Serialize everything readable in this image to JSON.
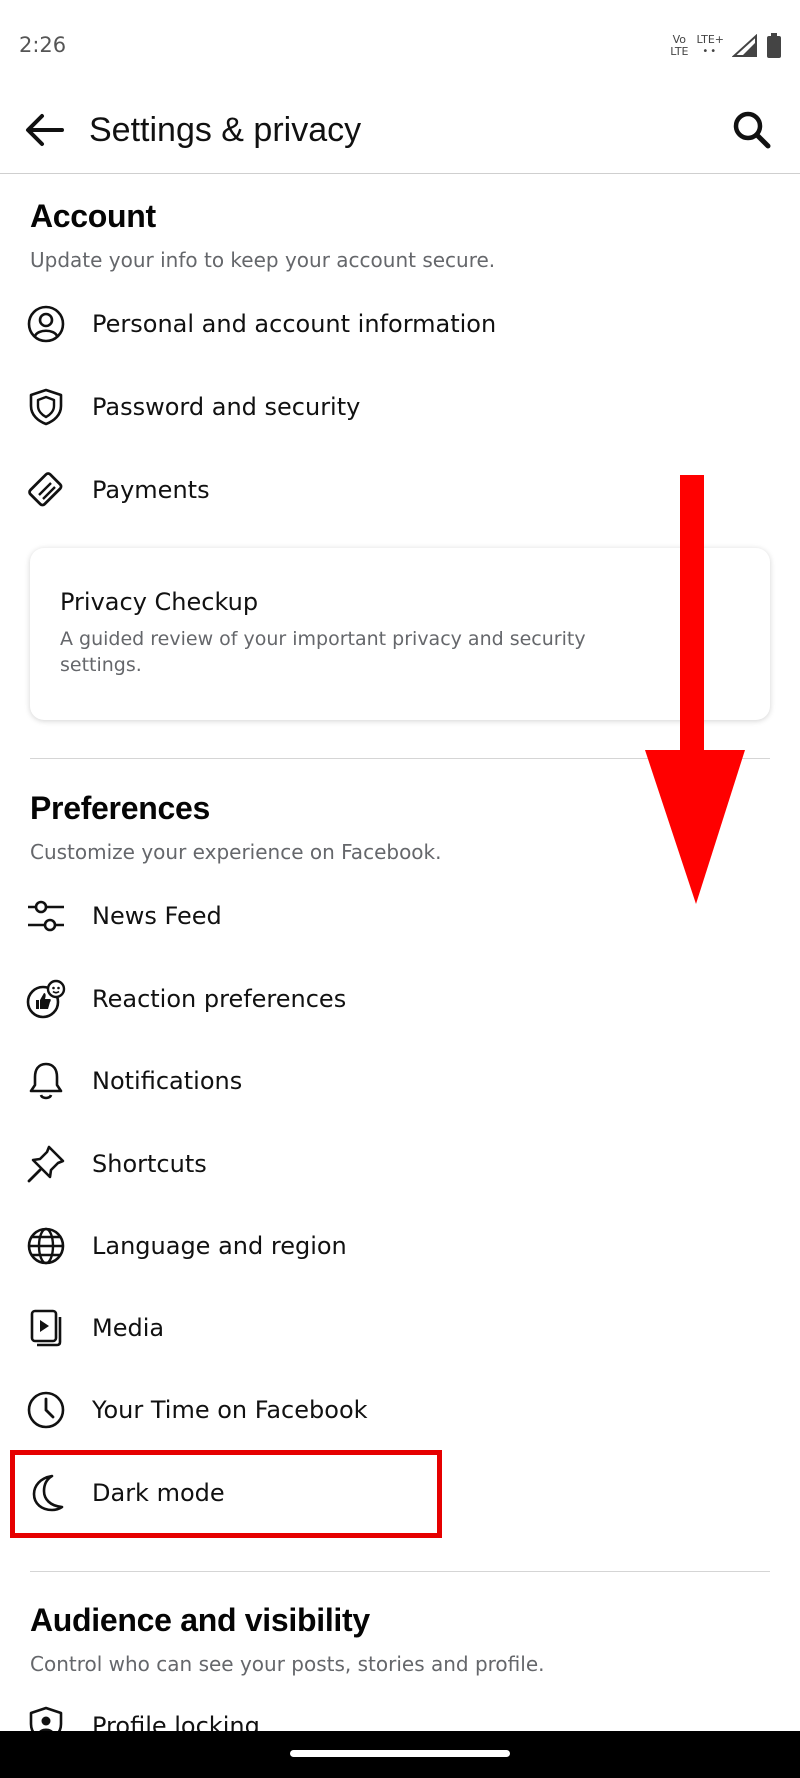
{
  "status_bar": {
    "time": "2:26",
    "volte_top": "Vo",
    "volte_bottom": "LTE",
    "lte_top": "LTE+",
    "lte_bottom": "••"
  },
  "header": {
    "title": "Settings & privacy",
    "back_icon": "arrow-left-icon",
    "search_icon": "search-icon"
  },
  "account": {
    "title": "Account",
    "subtitle": "Update your info to keep your account secure.",
    "items": [
      {
        "label": "Personal and account information",
        "icon": "user-circle-icon"
      },
      {
        "label": "Password and security",
        "icon": "shield-icon"
      },
      {
        "label": "Payments",
        "icon": "tag-icon"
      }
    ]
  },
  "privacy_checkup": {
    "title": "Privacy Checkup",
    "description": "A guided review of your important privacy and security settings."
  },
  "preferences": {
    "title": "Preferences",
    "subtitle": "Customize your experience on Facebook.",
    "items": [
      {
        "label": "News Feed",
        "icon": "sliders-icon"
      },
      {
        "label": "Reaction preferences",
        "icon": "reaction-icon"
      },
      {
        "label": "Notifications",
        "icon": "bell-icon"
      },
      {
        "label": "Shortcuts",
        "icon": "pin-icon"
      },
      {
        "label": "Language and region",
        "icon": "globe-icon"
      },
      {
        "label": "Media",
        "icon": "media-icon"
      },
      {
        "label": "Your Time on Facebook",
        "icon": "clock-icon"
      },
      {
        "label": "Dark mode",
        "icon": "moon-icon"
      }
    ]
  },
  "audience": {
    "title": "Audience and visibility",
    "subtitle": "Control who can see your posts, stories and profile.",
    "items": [
      {
        "label": "Profile locking",
        "icon": "profile-lock-icon"
      }
    ]
  },
  "annotations": {
    "arrow_color": "#ff0000",
    "highlight_color": "#e60000"
  }
}
